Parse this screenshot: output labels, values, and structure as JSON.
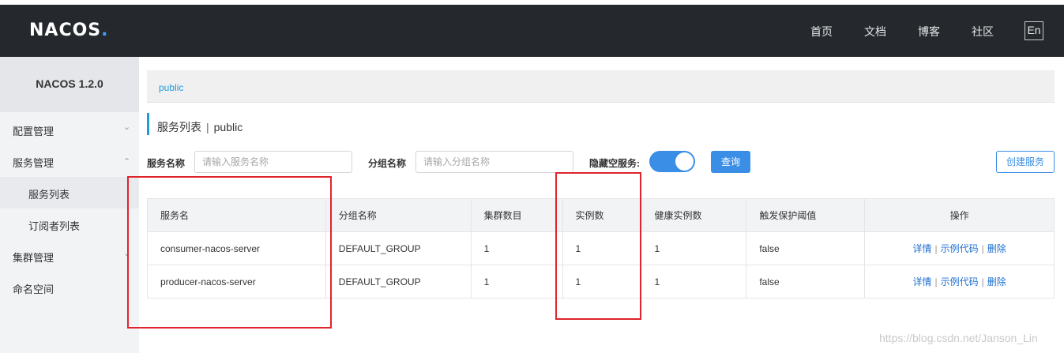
{
  "brand": {
    "logo_text": "NACOS",
    "logo_dot": "."
  },
  "topnav": {
    "links": [
      "首页",
      "文档",
      "博客",
      "社区"
    ],
    "lang": "En"
  },
  "sidebar": {
    "version": "NACOS 1.2.0",
    "items": [
      {
        "label": "配置管理",
        "chevron": "chevron-down"
      },
      {
        "label": "服务管理",
        "chevron": "chevron-up"
      },
      {
        "label": "服务列表"
      },
      {
        "label": "订阅者列表"
      },
      {
        "label": "集群管理",
        "chevron": "chevron-down"
      },
      {
        "label": "命名空间"
      }
    ]
  },
  "breadcrumb": {
    "namespace": "public"
  },
  "page": {
    "title": "服务列表",
    "namespace": "public"
  },
  "filters": {
    "service_label": "服务名称",
    "service_placeholder": "请输入服务名称",
    "group_label": "分组名称",
    "group_placeholder": "请输入分组名称",
    "hide_empty_label": "隐藏空服务:",
    "hide_empty_on": true,
    "query_button": "查询",
    "create_button": "创建服务"
  },
  "table": {
    "columns": [
      "服务名",
      "分组名称",
      "集群数目",
      "实例数",
      "健康实例数",
      "触发保护阈值",
      "操作"
    ],
    "rows": [
      {
        "service": "consumer-nacos-server",
        "group": "DEFAULT_GROUP",
        "clusters": "1",
        "instances": "1",
        "healthy": "1",
        "threshold": "false"
      },
      {
        "service": "producer-nacos-server",
        "group": "DEFAULT_GROUP",
        "clusters": "1",
        "instances": "1",
        "healthy": "1",
        "threshold": "false"
      }
    ],
    "actions": {
      "detail": "详情",
      "sample_code": "示例代码",
      "delete": "删除",
      "separator": "|"
    }
  },
  "watermark": "https://blog.csdn.net/Janson_Lin",
  "colors": {
    "accent": "#3a8ee6",
    "link": "#1e6fd0",
    "annotation": "#e0242b",
    "topbar": "#25292e"
  }
}
